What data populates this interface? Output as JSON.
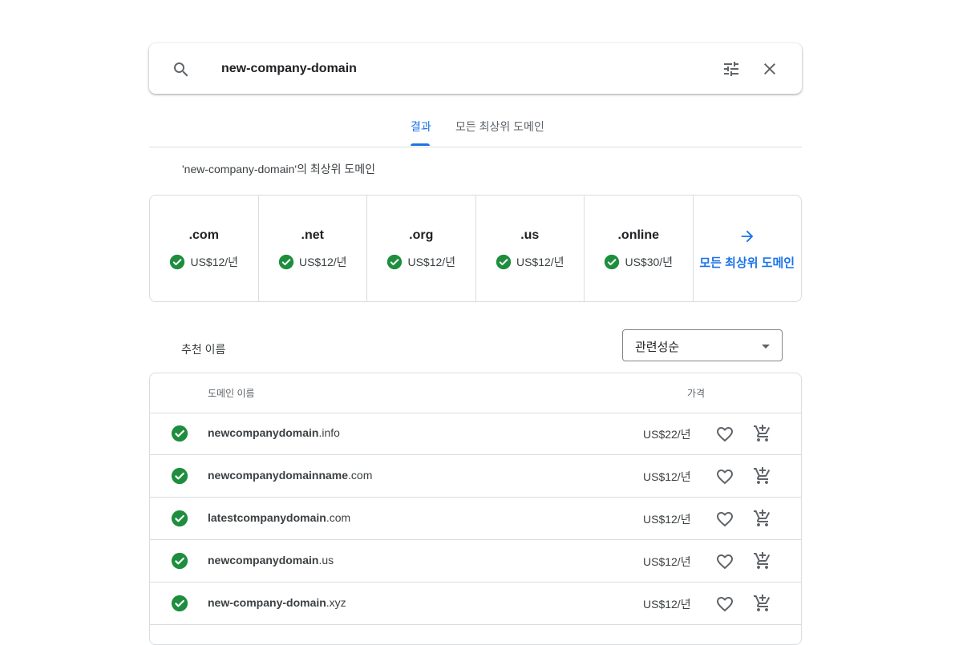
{
  "search": {
    "query": "new-company-domain"
  },
  "tabs": [
    {
      "label": "결과",
      "active": true
    },
    {
      "label": "모든 최상위 도메인",
      "active": false
    }
  ],
  "tld_section": {
    "heading": "'new-company-domain'의 최상위 도메인",
    "tlds": [
      {
        "name": ".com",
        "price": "US$12/년"
      },
      {
        "name": ".net",
        "price": "US$12/년"
      },
      {
        "name": ".org",
        "price": "US$12/년"
      },
      {
        "name": ".us",
        "price": "US$12/년"
      },
      {
        "name": ".online",
        "price": "US$30/년"
      }
    ],
    "all_link": "모든 최상위 도메인"
  },
  "recommended": {
    "heading": "추천 이름",
    "sort_value": "관련성순",
    "columns": {
      "name": "도메인 이름",
      "price": "가격"
    },
    "rows": [
      {
        "sld": "newcompanydomain",
        "tld": ".info",
        "price": "US$22/년"
      },
      {
        "sld": "newcompanydomainname",
        "tld": ".com",
        "price": "US$12/년"
      },
      {
        "sld": "latestcompanydomain",
        "tld": ".com",
        "price": "US$12/년"
      },
      {
        "sld": "newcompanydomain",
        "tld": ".us",
        "price": "US$12/년"
      },
      {
        "sld": "new-company-domain",
        "tld": ".xyz",
        "price": "US$12/년"
      }
    ]
  },
  "colors": {
    "accent": "#1a73e8",
    "available": "#1e8e3e",
    "border": "#dadce0"
  }
}
